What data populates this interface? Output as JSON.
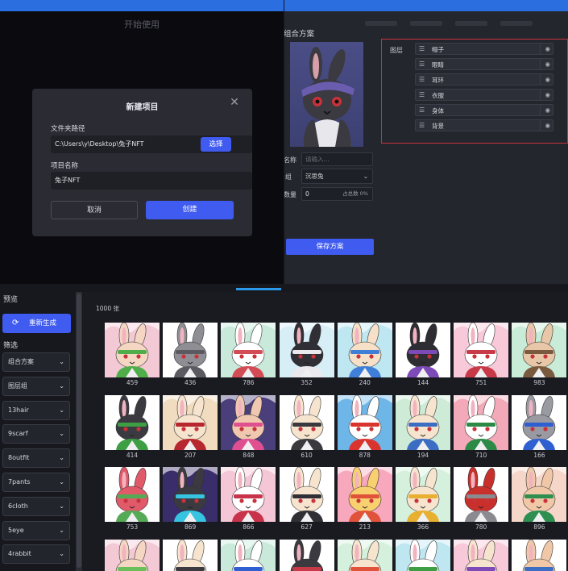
{
  "new_project": {
    "window_title": "开始使用",
    "dialog_title": "新建项目",
    "folder_label": "文件夹路径",
    "folder_value": "C:\\Users\\y\\Desktop\\兔子NFT",
    "choose_label": "选择",
    "name_label": "项目名称",
    "name_value": "兔子NFT",
    "cancel_label": "取消",
    "create_label": "创建",
    "close_icon": "close-icon"
  },
  "combo": {
    "heading": "组合方案",
    "layers_label": "图层",
    "layers": [
      "帽子",
      "眼睛",
      "耳环",
      "衣服",
      "身体",
      "背景"
    ],
    "name_label": "名称",
    "name_placeholder": "请输入...",
    "group_label": "组",
    "group_value": "沉思兔",
    "count_label": "数量",
    "count_value": "0",
    "percent_text": "占总数 0%",
    "save_label": "保存方案"
  },
  "generate": {
    "preview_label": "预览",
    "regen_label": "重新生成",
    "filter_label": "筛选",
    "count_text": "1000 张",
    "filters": [
      "组合方案",
      "图层组",
      "13hair",
      "9scarf",
      "8outfit",
      "7pants",
      "6cloth",
      "5eye",
      "4rabbit"
    ],
    "tiles": [
      {
        "id": "459",
        "bg": "#f3c9d6",
        "fur": "#f4d6c2",
        "acc": "#4fae4a"
      },
      {
        "id": "436",
        "bg": "#ffffff",
        "fur": "#8e8e94",
        "acc": "#5a5a60"
      },
      {
        "id": "786",
        "bg": "#c9eadb",
        "fur": "#ffffff",
        "acc": "#d34c55"
      },
      {
        "id": "352",
        "bg": "#d8eef7",
        "fur": "#2f2f35",
        "acc": "#e9e9ee"
      },
      {
        "id": "240",
        "bg": "#bfe7f2",
        "fur": "#f6e0c8",
        "acc": "#3f7fd8"
      },
      {
        "id": "144",
        "bg": "#ffffff",
        "fur": "#2d2d33",
        "acc": "#7d4bb8"
      },
      {
        "id": "751",
        "bg": "#f8c9d8",
        "fur": "#ffffff",
        "acc": "#c93a48"
      },
      {
        "id": "983",
        "bg": "#c9ecd8",
        "fur": "#e8c7a8",
        "acc": "#7a5a3f"
      },
      {
        "id": "414",
        "bg": "#ffffff",
        "fur": "#3a3a40",
        "acc": "#3d9e44"
      },
      {
        "id": "207",
        "bg": "#f2dcc0",
        "fur": "#f6e4cf",
        "acc": "#b7272f"
      },
      {
        "id": "848",
        "bg": "#4a3f7a",
        "fur": "#f0c8b0",
        "acc": "#e05090"
      },
      {
        "id": "610",
        "bg": "#ffffff",
        "fur": "#f6e4cf",
        "acc": "#3a3a3e"
      },
      {
        "id": "878",
        "bg": "#6fb6e8",
        "fur": "#ffffff",
        "acc": "#d9342e"
      },
      {
        "id": "194",
        "bg": "#cdebd6",
        "fur": "#f6e4cf",
        "acc": "#3b6dc2"
      },
      {
        "id": "710",
        "bg": "#f3a9b8",
        "fur": "#ffffff",
        "acc": "#2c8a46"
      },
      {
        "id": "166",
        "bg": "#ffffff",
        "fur": "#9a9aa2",
        "acc": "#2f5fd0"
      },
      {
        "id": "753",
        "bg": "#ffffff",
        "fur": "#e05a6a",
        "acc": "#55aa55"
      },
      {
        "id": "869",
        "bg": "#3a2e6a",
        "fur": "#3a3a40",
        "acc": "#36c4e0"
      },
      {
        "id": "866",
        "bg": "#f5c6d6",
        "fur": "#ffffff",
        "acc": "#c8324a"
      },
      {
        "id": "627",
        "bg": "#ffffff",
        "fur": "#f6e4cf",
        "acc": "#2f2f35"
      },
      {
        "id": "213",
        "bg": "#f7a8bd",
        "fur": "#f9d070",
        "acc": "#e0533a"
      },
      {
        "id": "366",
        "bg": "#d5f0dc",
        "fur": "#f6e4cf",
        "acc": "#e8b030"
      },
      {
        "id": "780",
        "bg": "#ffffff",
        "fur": "#c9302c",
        "acc": "#8a8a90"
      },
      {
        "id": "896",
        "bg": "#f6d6c8",
        "fur": "#f0c8a8",
        "acc": "#2e8f50"
      },
      {
        "id": "",
        "bg": "#f3c9d6",
        "fur": "#f4d6c2",
        "acc": "#6abf5a"
      },
      {
        "id": "",
        "bg": "#ffffff",
        "fur": "#f6e4cf",
        "acc": "#3a3a40"
      },
      {
        "id": "",
        "bg": "#c9eadb",
        "fur": "#ffffff",
        "acc": "#2f5fd0"
      },
      {
        "id": "",
        "bg": "#ffffff",
        "fur": "#3a3a40",
        "acc": "#c93a48"
      },
      {
        "id": "",
        "bg": "#d5f0dc",
        "fur": "#f6e4cf",
        "acc": "#e0533a"
      },
      {
        "id": "",
        "bg": "#bfe7f2",
        "fur": "#ffffff",
        "acc": "#3d9e44"
      },
      {
        "id": "",
        "bg": "#f8c9d8",
        "fur": "#f6e4cf",
        "acc": "#7d4bb8"
      },
      {
        "id": "",
        "bg": "#ffffff",
        "fur": "#f0c8a8",
        "acc": "#3b6dc2"
      }
    ]
  },
  "colors": {
    "accent": "#3f5bf0",
    "highlight_box": "#c8323a",
    "title_bar": "#2a6ee0"
  }
}
